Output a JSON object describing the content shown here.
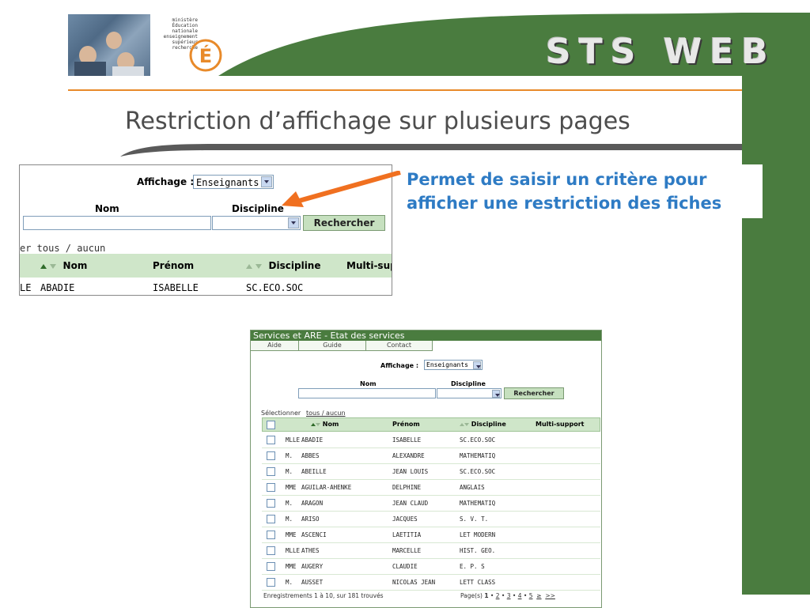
{
  "header": {
    "ministry_lines": [
      "ministère",
      "Éducation",
      "nationale",
      "enseignement",
      "supérieur",
      "recherche"
    ],
    "app_title": "STS WEB"
  },
  "slide": {
    "title": "Restriction d’affichage sur plusieurs pages",
    "callout": "Permet de saisir un critère pour afficher une restriction des fiches"
  },
  "zoom": {
    "affichage_label": "Affichage :",
    "affichage_value": "Enseignants",
    "nom_label": "Nom",
    "discipline_label": "Discipline",
    "search_button": "Rechercher",
    "select_all_text": "er tous / aucun",
    "columns": [
      "Nom",
      "Prénom",
      "Discipline",
      "Multi-sup"
    ],
    "first_row": {
      "civ": "LE",
      "nom": "ABADIE",
      "prenom": "ISABELLE",
      "discipline": "SC.ECO.SOC"
    }
  },
  "screen": {
    "title": "Services et ARE - Etat des services",
    "nav": [
      "Aide",
      "Guide",
      "Contact"
    ],
    "affichage_label": "Affichage :",
    "affichage_value": "Enseignants",
    "nom_label": "Nom",
    "discipline_label": "Discipline",
    "search_button": "Rechercher",
    "select_label": "Sélectionner",
    "select_links": "tous / aucun",
    "columns": {
      "nom": "Nom",
      "prenom": "Prénom",
      "discipline": "Discipline",
      "multi": "Multi-support"
    },
    "rows": [
      {
        "civ": "MLLE",
        "nom": "ABADIE",
        "prenom": "ISABELLE",
        "discipline": "SC.ECO.SOC"
      },
      {
        "civ": "M.",
        "nom": "ABBES",
        "prenom": "ALEXANDRE",
        "discipline": "MATHEMATIQ"
      },
      {
        "civ": "M.",
        "nom": "ABEILLE",
        "prenom": "JEAN LOUIS",
        "discipline": "SC.ECO.SOC"
      },
      {
        "civ": "MME",
        "nom": "AGUILAR-AHENKE",
        "prenom": "DELPHINE",
        "discipline": "ANGLAIS"
      },
      {
        "civ": "M.",
        "nom": "ARAGON",
        "prenom": "JEAN CLAUD",
        "discipline": "MATHEMATIQ"
      },
      {
        "civ": "M.",
        "nom": "ARISO",
        "prenom": "JACQUES",
        "discipline": "S. V. T."
      },
      {
        "civ": "MME",
        "nom": "ASCENCI",
        "prenom": "LAETITIA",
        "discipline": "LET MODERN"
      },
      {
        "civ": "MLLE",
        "nom": "ATHES",
        "prenom": "MARCELLE",
        "discipline": "HIST. GEO."
      },
      {
        "civ": "MME",
        "nom": "AUGERY",
        "prenom": "CLAUDIE",
        "discipline": "E. P. S"
      },
      {
        "civ": "M.",
        "nom": "AUSSET",
        "prenom": "NICOLAS JEAN",
        "discipline": "LETT CLASS"
      }
    ],
    "footer_count": "Enregistrements 1 à 10, sur 181 trouvés",
    "footer_pages_label": "Page(s)",
    "pages": [
      "1",
      "2",
      "3",
      "4",
      "5",
      "≥",
      ">>"
    ]
  },
  "colors": {
    "green": "#4a7c3f",
    "orange": "#e88a2a",
    "callout_blue": "#2e7bc4",
    "header_row": "#cfe6c9"
  }
}
